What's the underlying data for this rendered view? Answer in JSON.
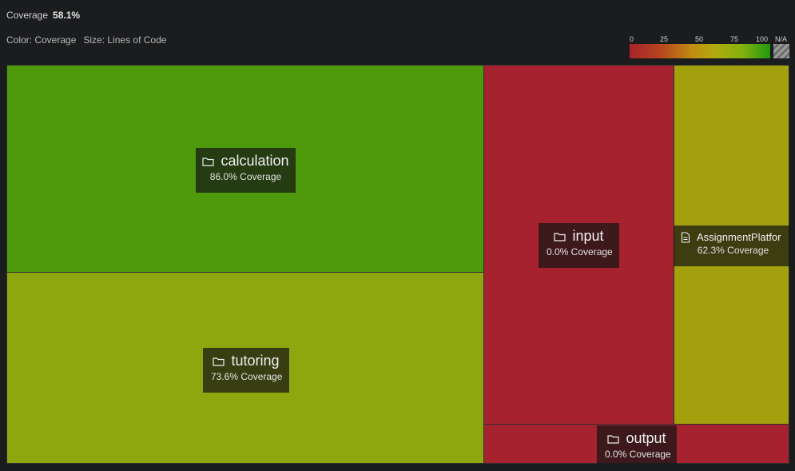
{
  "header": {
    "coverage_label": "Coverage",
    "coverage_value": "58.1%",
    "color_label": "Color: Coverage",
    "size_label": "Size: Lines of Code"
  },
  "legend": {
    "ticks": [
      "0",
      "25",
      "50",
      "75",
      "100"
    ],
    "na_label": "N/A",
    "colors": [
      "#a8232c",
      "#c08d12",
      "#86b00f",
      "#1f9a0e"
    ]
  },
  "treemap": {
    "nodes": [
      {
        "name": "calculation",
        "coverage": "86.0% Coverage",
        "kind": "folder",
        "color": "#4e9a0c"
      },
      {
        "name": "tutoring",
        "coverage": "73.6% Coverage",
        "kind": "folder",
        "color": "#8fa70f"
      },
      {
        "name": "input",
        "coverage": "0.0% Coverage",
        "kind": "folder",
        "color": "#a6222f"
      },
      {
        "name": "AssignmentPlatfor",
        "coverage": "62.3% Coverage",
        "kind": "file",
        "color": "#a49f0c"
      },
      {
        "name": "output",
        "coverage": "0.0% Coverage",
        "kind": "folder",
        "color": "#a6222f"
      }
    ]
  }
}
